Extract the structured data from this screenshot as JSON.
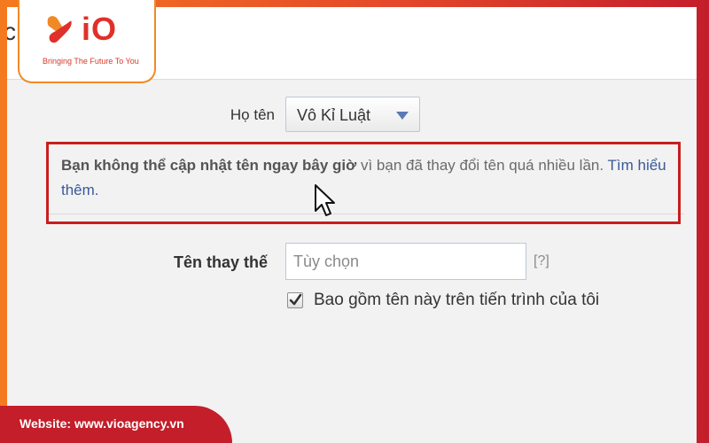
{
  "header": {
    "title_fragment": "ch"
  },
  "brand": {
    "logo_text": "iO",
    "tagline": "Bringing The Future To You",
    "colors": {
      "orange": "#f08a24",
      "red": "#e0302a",
      "footer": "#c31e2a"
    }
  },
  "name_section": {
    "label": "Họ tên",
    "selected_name": "Vô Kỉ Luật"
  },
  "notice": {
    "bold_text": "Bạn không thể cập nhật tên ngay bây giờ",
    "body_text": " vì bạn đã thay đổi tên quá nhiều lần. ",
    "link_text": "Tìm hiểu thêm.",
    "highlight_color": "#c81e1e"
  },
  "alternate_name": {
    "label": "Tên thay thế",
    "placeholder": "Tùy chọn",
    "help_link": "[?]"
  },
  "timeline_option": {
    "label": "Bao gồm tên này trên tiến trình của tôi",
    "checked": true
  },
  "footer": {
    "website": "Website: www.vioagency.vn"
  },
  "icons": {
    "cursor": "mouse-pointer-icon",
    "caret": "chevron-down-icon",
    "check": "checkmark-icon"
  }
}
